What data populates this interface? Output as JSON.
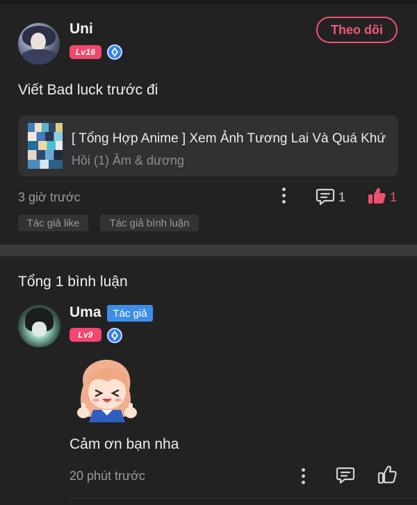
{
  "post": {
    "author": {
      "name": "Uni",
      "level": "Lv16"
    },
    "follow_label": "Theo dõi",
    "text": "Viết Bad luck trước đi",
    "linked_content": {
      "title": "[ Tổng Hợp Anime ] Xem Ảnh Tương Lai Và Quá Khứ",
      "subtitle": "Hồi (1) Âm & dương"
    },
    "time": "3 giờ trước",
    "comment_count": "1",
    "like_count": "1",
    "tags": [
      "Tác giả like",
      "Tác giả bình luận"
    ]
  },
  "comments_section": {
    "total_label": "Tổng 1 bình luận",
    "comments": [
      {
        "author": "Uma",
        "author_badge": "Tác giả",
        "level": "Lv9",
        "text": "Cảm ơn bạn nha",
        "time": "20 phút trước"
      }
    ]
  },
  "colors": {
    "background": "#222223",
    "card": "#313133",
    "accent_pink": "#f2476e",
    "like_red": "#f0506e",
    "author_blue": "#3d8ee6",
    "muted_text": "#9b9b9f"
  },
  "icons": [
    "avatar",
    "level-badge",
    "diamond-icon",
    "more-icon",
    "comment-icon",
    "like-icon",
    "sticker"
  ]
}
